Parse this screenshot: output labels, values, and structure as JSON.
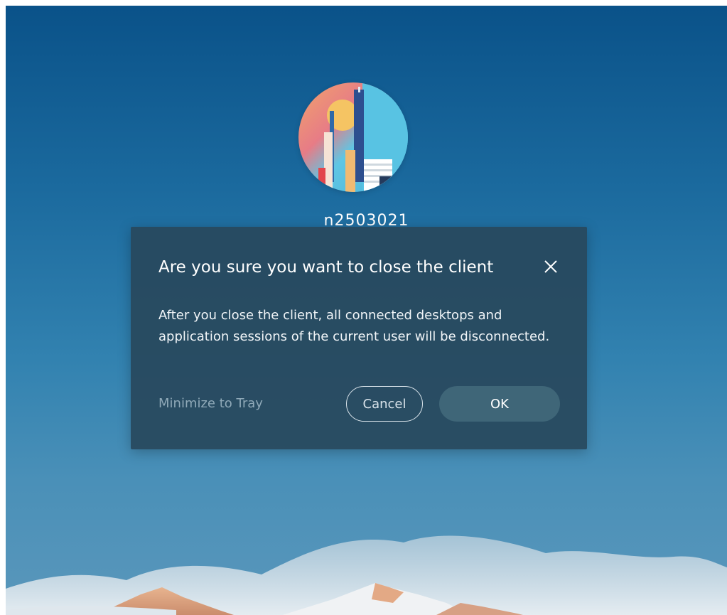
{
  "user": {
    "name": "n2503021",
    "avatar_icon": "city-skyline-avatar-icon"
  },
  "dialog": {
    "title": "Are you sure you want to close the client",
    "message": "After you close the client, all connected desktops and application sessions of the current user will be disconnected.",
    "minimize_label": "Minimize to Tray",
    "cancel_label": "Cancel",
    "ok_label": "OK",
    "close_icon": "close-icon"
  },
  "colors": {
    "dialog_bg": "#28485c",
    "ok_button_bg": "#3f6678",
    "minimize_text": "#8fa9b8"
  }
}
